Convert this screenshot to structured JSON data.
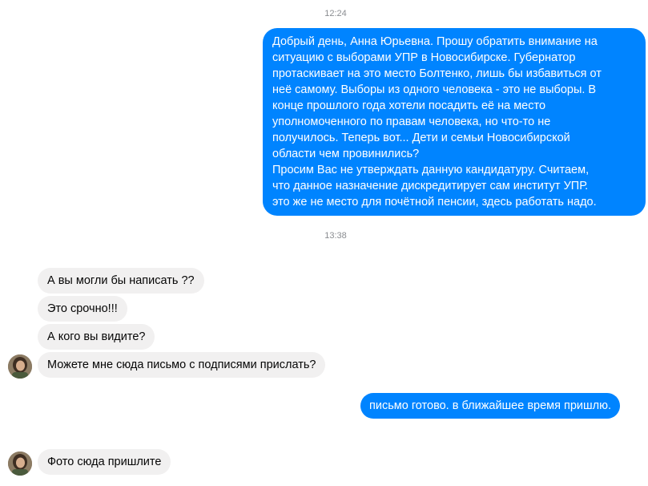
{
  "conversation": {
    "timestamp_1": "12:24",
    "timestamp_2": "13:38",
    "outgoing_long": {
      "lines": [
        "Добрый день, Анна Юрьевна. Прошу обратить внимание на",
        "ситуацию с выборами УПР в Новосибирске. Губернатор",
        "протаскивает на это место Болтенко, лишь бы избавиться от",
        "неё самому. Выборы из одного человека - это не выборы. В",
        "конце прошлого года хотели посадить её на место",
        "уполномоченного по правам человека, но что-то не",
        "получилось. Теперь вот... Дети и семьи Новосибирской",
        "области чем провинились?",
        "Просим Вас не утверждать данную кандидатуру. Считаем,",
        "что данное назначение дискредитирует сам институт УПР.",
        "это же не место для почётной пенсии, здесь работать надо."
      ]
    },
    "incoming_1": "А вы могли бы написать ??",
    "incoming_2": "Это срочно!!!",
    "incoming_3": "А кого вы видите?",
    "incoming_4": "Можете мне сюда письмо с подписями прислать?",
    "outgoing_short": "письмо готово. в ближайшее время пришлю.",
    "incoming_5": "Фото сюда пришлите"
  },
  "colors": {
    "outgoing_bubble": "#0084ff",
    "incoming_bubble": "#f1f0f0",
    "timestamp_text": "#8a8d91"
  },
  "icons": {
    "avatar": "contact-avatar-icon"
  }
}
